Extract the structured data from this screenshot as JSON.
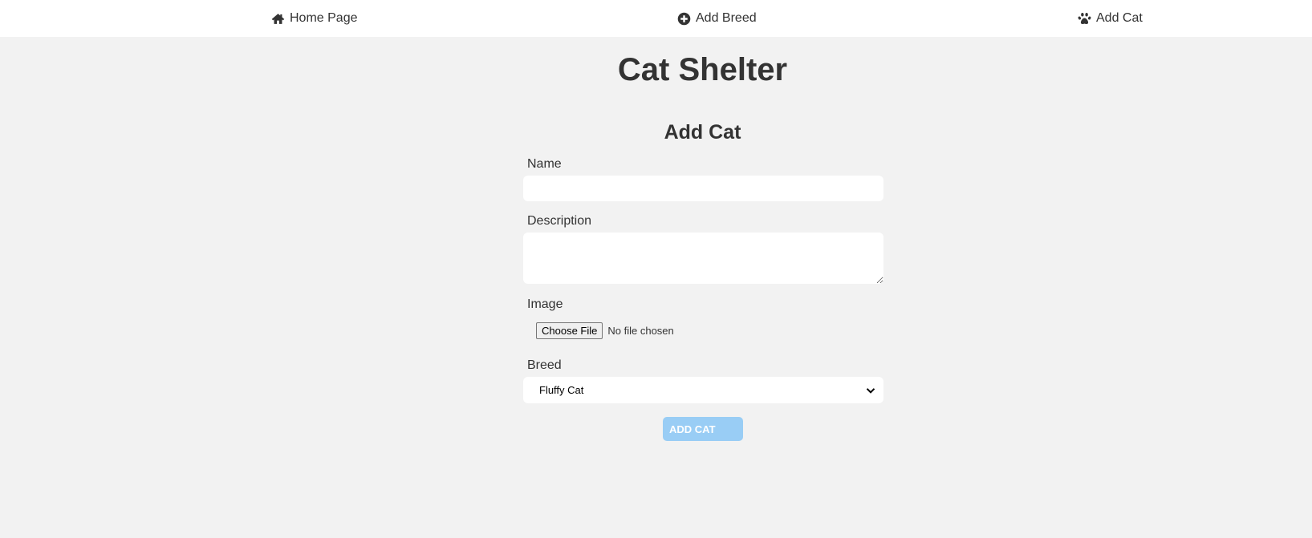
{
  "nav": {
    "home_label": "Home Page",
    "add_breed_label": "Add Breed",
    "add_cat_label": "Add Cat"
  },
  "header": {
    "title": "Cat Shelter"
  },
  "form": {
    "title": "Add Cat",
    "name_label": "Name",
    "name_value": "",
    "description_label": "Description",
    "description_value": "",
    "image_label": "Image",
    "file_button_label": "Choose File",
    "file_status": "No file chosen",
    "breed_label": "Breed",
    "breed_selected": "Fluffy Cat",
    "submit_label": "ADD CAT"
  },
  "colors": {
    "background": "#f2f2f2",
    "navbar": "#ffffff",
    "text": "#333333",
    "button": "#99cdf5"
  },
  "icons": {
    "home": "home-icon",
    "add_breed": "plus-circle-icon",
    "add_cat": "paw-icon",
    "select": "chevron-down-icon"
  }
}
